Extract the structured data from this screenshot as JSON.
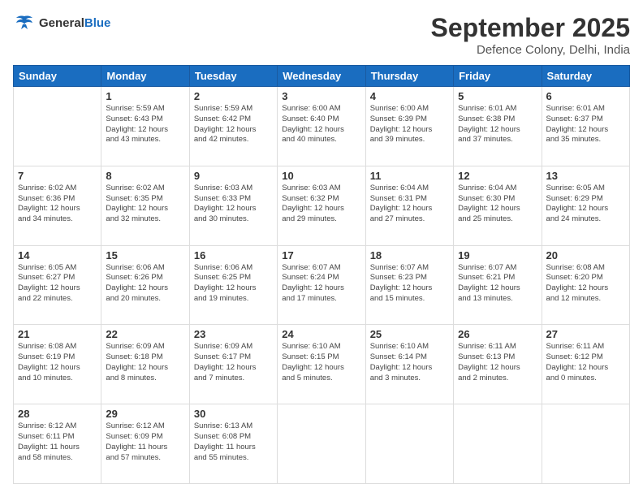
{
  "logo": {
    "line1": "General",
    "line2": "Blue"
  },
  "title": "September 2025",
  "subtitle": "Defence Colony, Delhi, India",
  "days_of_week": [
    "Sunday",
    "Monday",
    "Tuesday",
    "Wednesday",
    "Thursday",
    "Friday",
    "Saturday"
  ],
  "weeks": [
    [
      {
        "day": "",
        "info": ""
      },
      {
        "day": "1",
        "info": "Sunrise: 5:59 AM\nSunset: 6:43 PM\nDaylight: 12 hours\nand 43 minutes."
      },
      {
        "day": "2",
        "info": "Sunrise: 5:59 AM\nSunset: 6:42 PM\nDaylight: 12 hours\nand 42 minutes."
      },
      {
        "day": "3",
        "info": "Sunrise: 6:00 AM\nSunset: 6:40 PM\nDaylight: 12 hours\nand 40 minutes."
      },
      {
        "day": "4",
        "info": "Sunrise: 6:00 AM\nSunset: 6:39 PM\nDaylight: 12 hours\nand 39 minutes."
      },
      {
        "day": "5",
        "info": "Sunrise: 6:01 AM\nSunset: 6:38 PM\nDaylight: 12 hours\nand 37 minutes."
      },
      {
        "day": "6",
        "info": "Sunrise: 6:01 AM\nSunset: 6:37 PM\nDaylight: 12 hours\nand 35 minutes."
      }
    ],
    [
      {
        "day": "7",
        "info": "Sunrise: 6:02 AM\nSunset: 6:36 PM\nDaylight: 12 hours\nand 34 minutes."
      },
      {
        "day": "8",
        "info": "Sunrise: 6:02 AM\nSunset: 6:35 PM\nDaylight: 12 hours\nand 32 minutes."
      },
      {
        "day": "9",
        "info": "Sunrise: 6:03 AM\nSunset: 6:33 PM\nDaylight: 12 hours\nand 30 minutes."
      },
      {
        "day": "10",
        "info": "Sunrise: 6:03 AM\nSunset: 6:32 PM\nDaylight: 12 hours\nand 29 minutes."
      },
      {
        "day": "11",
        "info": "Sunrise: 6:04 AM\nSunset: 6:31 PM\nDaylight: 12 hours\nand 27 minutes."
      },
      {
        "day": "12",
        "info": "Sunrise: 6:04 AM\nSunset: 6:30 PM\nDaylight: 12 hours\nand 25 minutes."
      },
      {
        "day": "13",
        "info": "Sunrise: 6:05 AM\nSunset: 6:29 PM\nDaylight: 12 hours\nand 24 minutes."
      }
    ],
    [
      {
        "day": "14",
        "info": "Sunrise: 6:05 AM\nSunset: 6:27 PM\nDaylight: 12 hours\nand 22 minutes."
      },
      {
        "day": "15",
        "info": "Sunrise: 6:06 AM\nSunset: 6:26 PM\nDaylight: 12 hours\nand 20 minutes."
      },
      {
        "day": "16",
        "info": "Sunrise: 6:06 AM\nSunset: 6:25 PM\nDaylight: 12 hours\nand 19 minutes."
      },
      {
        "day": "17",
        "info": "Sunrise: 6:07 AM\nSunset: 6:24 PM\nDaylight: 12 hours\nand 17 minutes."
      },
      {
        "day": "18",
        "info": "Sunrise: 6:07 AM\nSunset: 6:23 PM\nDaylight: 12 hours\nand 15 minutes."
      },
      {
        "day": "19",
        "info": "Sunrise: 6:07 AM\nSunset: 6:21 PM\nDaylight: 12 hours\nand 13 minutes."
      },
      {
        "day": "20",
        "info": "Sunrise: 6:08 AM\nSunset: 6:20 PM\nDaylight: 12 hours\nand 12 minutes."
      }
    ],
    [
      {
        "day": "21",
        "info": "Sunrise: 6:08 AM\nSunset: 6:19 PM\nDaylight: 12 hours\nand 10 minutes."
      },
      {
        "day": "22",
        "info": "Sunrise: 6:09 AM\nSunset: 6:18 PM\nDaylight: 12 hours\nand 8 minutes."
      },
      {
        "day": "23",
        "info": "Sunrise: 6:09 AM\nSunset: 6:17 PM\nDaylight: 12 hours\nand 7 minutes."
      },
      {
        "day": "24",
        "info": "Sunrise: 6:10 AM\nSunset: 6:15 PM\nDaylight: 12 hours\nand 5 minutes."
      },
      {
        "day": "25",
        "info": "Sunrise: 6:10 AM\nSunset: 6:14 PM\nDaylight: 12 hours\nand 3 minutes."
      },
      {
        "day": "26",
        "info": "Sunrise: 6:11 AM\nSunset: 6:13 PM\nDaylight: 12 hours\nand 2 minutes."
      },
      {
        "day": "27",
        "info": "Sunrise: 6:11 AM\nSunset: 6:12 PM\nDaylight: 12 hours\nand 0 minutes."
      }
    ],
    [
      {
        "day": "28",
        "info": "Sunrise: 6:12 AM\nSunset: 6:11 PM\nDaylight: 11 hours\nand 58 minutes."
      },
      {
        "day": "29",
        "info": "Sunrise: 6:12 AM\nSunset: 6:09 PM\nDaylight: 11 hours\nand 57 minutes."
      },
      {
        "day": "30",
        "info": "Sunrise: 6:13 AM\nSunset: 6:08 PM\nDaylight: 11 hours\nand 55 minutes."
      },
      {
        "day": "",
        "info": ""
      },
      {
        "day": "",
        "info": ""
      },
      {
        "day": "",
        "info": ""
      },
      {
        "day": "",
        "info": ""
      }
    ]
  ]
}
